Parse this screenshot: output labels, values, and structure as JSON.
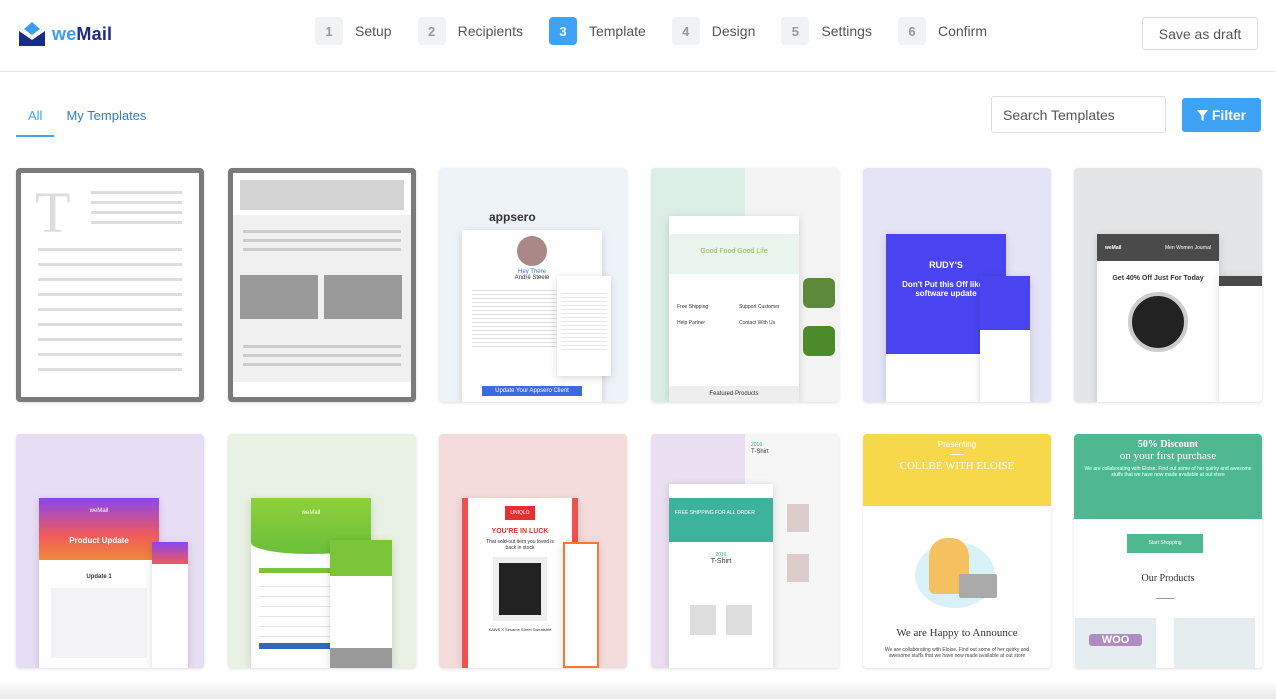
{
  "brand": {
    "name_prefix": "we",
    "name_suffix": "Mail",
    "logo_icon": "envelope-icon",
    "accent": "#3ea3f4"
  },
  "steps": [
    {
      "num": "1",
      "label": "Setup",
      "active": false
    },
    {
      "num": "2",
      "label": "Recipients",
      "active": false
    },
    {
      "num": "3",
      "label": "Template",
      "active": true
    },
    {
      "num": "4",
      "label": "Design",
      "active": false
    },
    {
      "num": "5",
      "label": "Settings",
      "active": false
    },
    {
      "num": "6",
      "label": "Confirm",
      "active": false
    }
  ],
  "header": {
    "save_draft": "Save as draft"
  },
  "tabs": [
    {
      "label": "All",
      "active": true
    },
    {
      "label": "My Templates",
      "active": false
    }
  ],
  "search": {
    "placeholder": "Search Templates"
  },
  "filter": {
    "label": "Filter",
    "icon": "filter-icon"
  },
  "templates": {
    "t3": {
      "brand": "appsero",
      "greeting": "Hey There",
      "name": "André Steele",
      "cta": "Update Your Appsero Client"
    },
    "t4": {
      "headline": "Good Food Good Life",
      "features": [
        "Free Shipping",
        "Support Customer",
        "Help Partner",
        "Contact With Us"
      ],
      "footer": "Featured Products"
    },
    "t5": {
      "brand": "RUDY'S",
      "headline": "Don't Put this Off like a software update"
    },
    "t6": {
      "brand": "weMail",
      "nav": "Men  Women  Journal",
      "headline": "Get 40% Off Just For Today"
    },
    "t7": {
      "brand": "weMail",
      "headline": "Product Update",
      "sub": "Update 1"
    },
    "t8": {
      "brand": "weMail"
    },
    "t9": {
      "brand": "UNIQLO",
      "headline": "YOU'RE IN LUCK",
      "sub": "That sold-out item you loved is back in stock",
      "product": "KAWS X Sesame Street Sweatshirt"
    },
    "t10": {
      "year": "2016",
      "product": "T-Shirt",
      "banner": "FREE SHIPPING FOR ALL ORDER"
    },
    "t11": {
      "kicker": "Presenting",
      "headline": "COLLBE WITH ELOISE",
      "title": "We are Happy to Announce",
      "body": "We are collaborating with Eloise. Find out some of her quirky and awesome stuffs that we have now made available at out store"
    },
    "t12": {
      "headline": "50% Discount",
      "sub": "on your first purchase",
      "body": "We are collaborating with Eloise. Find out some of her quirky and awesome stuffs that we have now made available at out store",
      "cta": "Start Shopping",
      "section": "Our Products",
      "badge": "WOO"
    }
  }
}
